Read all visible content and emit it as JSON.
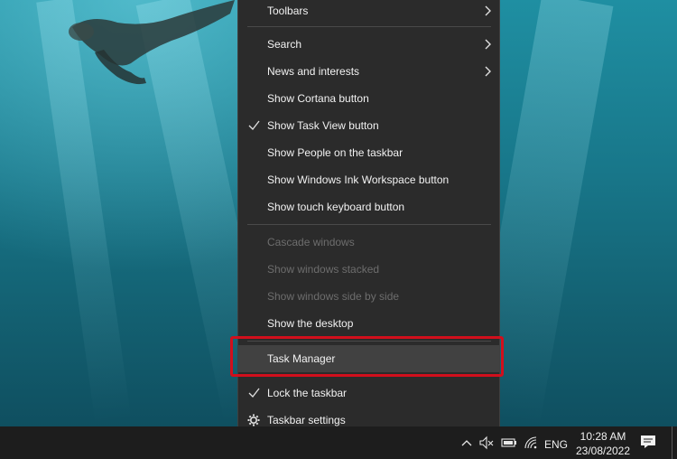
{
  "menu": {
    "toolbars": "Toolbars",
    "search": "Search",
    "news": "News and interests",
    "cortana": "Show Cortana button",
    "task_view": "Show Task View button",
    "people": "Show People on the taskbar",
    "ink": "Show Windows Ink Workspace button",
    "touch_keyboard": "Show touch keyboard button",
    "cascade": "Cascade windows",
    "stacked": "Show windows stacked",
    "side_by_side": "Show windows side by side",
    "show_desktop": "Show the desktop",
    "task_manager": "Task Manager",
    "lock": "Lock the taskbar",
    "settings": "Taskbar settings"
  },
  "tray": {
    "language": "ENG",
    "time": "10:28 AM",
    "date": "23/08/2022"
  },
  "colors": {
    "menu_bg": "#2b2b2b",
    "highlight_border": "#d10f1c",
    "taskbar_bg": "#1d1d1d"
  }
}
